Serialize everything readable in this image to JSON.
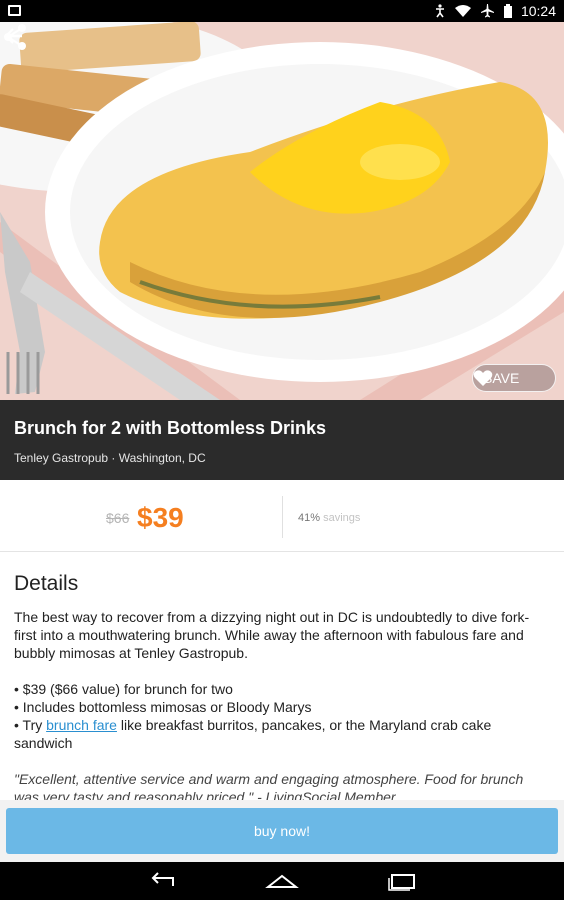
{
  "status_bar": {
    "time": "10:24"
  },
  "deal": {
    "title": "Brunch for 2 with Bottomless Drinks",
    "merchant": "Tenley Gastropub · Washington, DC",
    "save_label": "SAVE"
  },
  "price": {
    "original": "$66",
    "current": "$39",
    "savings_percent": "41%",
    "savings_label": "savings"
  },
  "details": {
    "heading": "Details",
    "intro_before_link": "The best way to recover from a dizzying night out in ",
    "intro_link": "DC",
    "intro_after_link": " is undoubtedly to dive fork-first into a mouthwatering brunch. While away the afternoon with fabulous fare and bubbly mimosas at Tenley Gastropub.",
    "bullet_1": "• $39 ($66 value) for brunch for two",
    "bullet_2": "• Includes bottomless mimosas or Bloody Marys",
    "bullet_3_before_link": "• Try ",
    "bullet_3_link": "brunch fare",
    "bullet_3_after_link": " like breakfast burritos, pancakes, or the Maryland crab cake sandwich",
    "quote": "\"Excellent, attentive service and warm and engaging atmosphere. Food for brunch was very tasty and reasonably priced.\" - LivingSocial Member"
  },
  "buy_button": {
    "label": "buy now!"
  },
  "colors": {
    "accent": "#f57f20",
    "button": "#6bb8e6",
    "band": "#2b2b2b"
  }
}
